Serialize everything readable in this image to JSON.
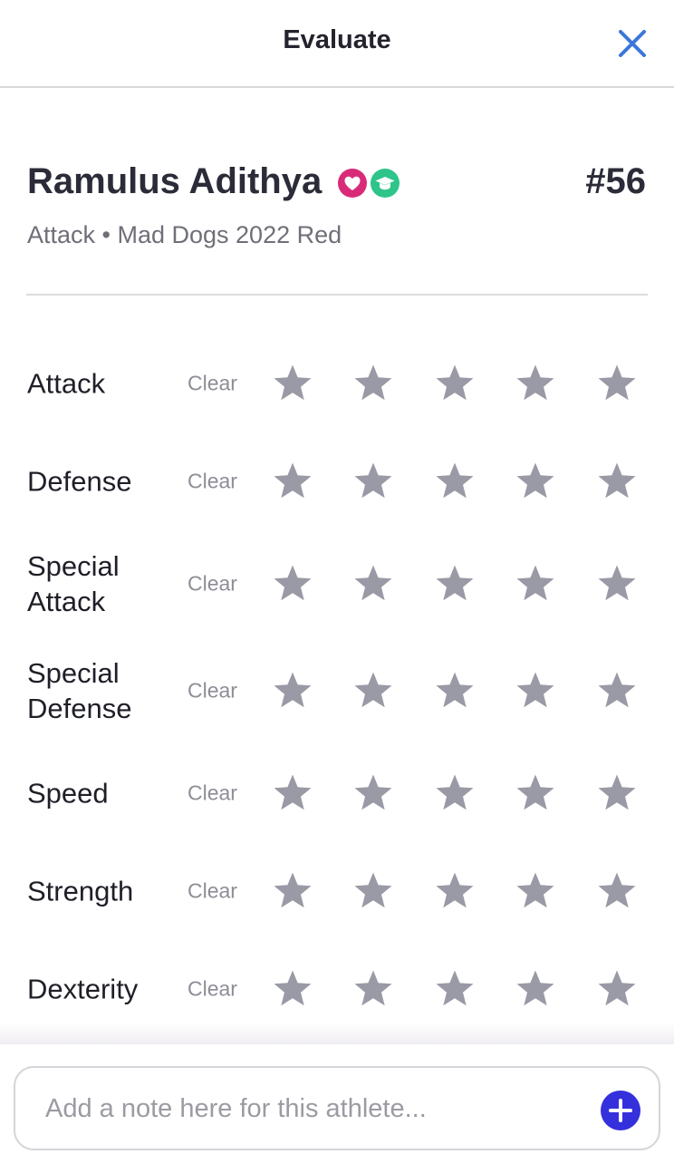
{
  "header": {
    "title": "Evaluate",
    "close_icon": "close-icon",
    "accent_color": "#3b76d9"
  },
  "athlete": {
    "name": "Ramulus Adithya",
    "badges": [
      {
        "icon": "heart-icon",
        "color": "#d92a78"
      },
      {
        "icon": "graduation-cap-icon",
        "color": "#2ec48a"
      }
    ],
    "jersey": "#56",
    "subtitle": "Attack • Mad Dogs 2022 Red"
  },
  "ratings": {
    "clear_label": "Clear",
    "max_stars": 5,
    "star_color_empty": "#9a9aa6",
    "items": [
      {
        "label": "Attack",
        "value": 0
      },
      {
        "label": "Defense",
        "value": 0
      },
      {
        "label": "Special Attack",
        "value": 0
      },
      {
        "label": "Special Defense",
        "value": 0
      },
      {
        "label": "Speed",
        "value": 0
      },
      {
        "label": "Strength",
        "value": 0
      },
      {
        "label": "Dexterity",
        "value": 0
      }
    ]
  },
  "note": {
    "placeholder": "Add a note here for this athlete...",
    "value": "",
    "add_icon": "plus-circle-icon",
    "add_color": "#3430dc"
  }
}
